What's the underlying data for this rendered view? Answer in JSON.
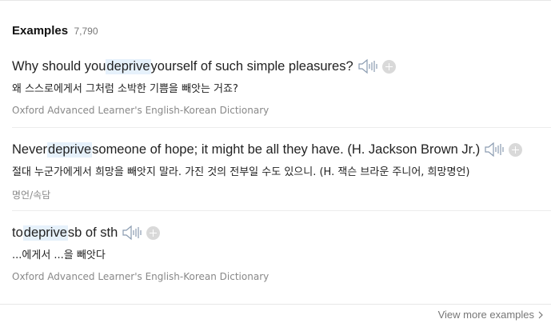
{
  "header": {
    "title": "Examples",
    "count": "7,790"
  },
  "examples": [
    {
      "before": "Why should you ",
      "keyword": "deprive",
      "after": " yourself of such simple pleasures?",
      "translation": "왜 스스로에게서 그처럼 소박한 기쁨을 빼앗는 거죠?",
      "source": "Oxford Advanced Learner's English-Korean Dictionary"
    },
    {
      "before": "Never ",
      "keyword": "deprive",
      "after": " someone of hope; it might be all they have. (H. Jackson Brown Jr.)",
      "translation": "절대 누군가에게서 희망을 빼앗지 말라. 가진 것의 전부일 수도 있으니. (H. 잭슨 브라운 주니어, 희망명언)",
      "source": "명언/속담"
    },
    {
      "before": "to ",
      "keyword": "deprive",
      "after": " sb of sth",
      "translation": "...에게서 ...을 빼앗다",
      "source": "Oxford Advanced Learner's English-Korean Dictionary"
    }
  ],
  "footer": {
    "more_label": "View more examples"
  },
  "colors": {
    "highlight": "#e6f1fb",
    "muted": "#888888",
    "plus": "#d9d9d9"
  },
  "icons": {
    "audio": "speaker-icon",
    "add": "plus-circle-icon",
    "more": "chevron-right-icon"
  }
}
